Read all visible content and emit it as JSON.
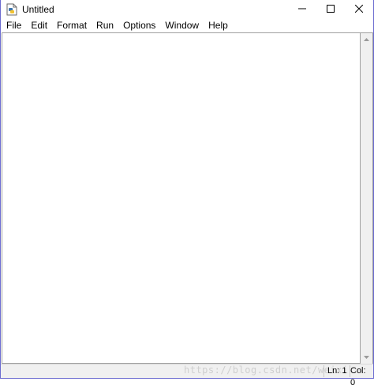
{
  "window": {
    "title": "Untitled"
  },
  "titlebar": {
    "icons": {
      "app": "python-idle-icon",
      "minimize": "minimize-icon",
      "maximize": "maximize-icon",
      "close": "close-icon"
    }
  },
  "menu": {
    "items": [
      {
        "label": "File"
      },
      {
        "label": "Edit"
      },
      {
        "label": "Format"
      },
      {
        "label": "Run"
      },
      {
        "label": "Options"
      },
      {
        "label": "Window"
      },
      {
        "label": "Help"
      }
    ]
  },
  "editor": {
    "content": ""
  },
  "statusbar": {
    "line": "Ln: 1",
    "col": "Col: 0",
    "watermark": "https://blog.csdn.net/weixi"
  },
  "colors": {
    "window_border": "#6b6bd0",
    "status_bg": "#f0f0f0"
  }
}
